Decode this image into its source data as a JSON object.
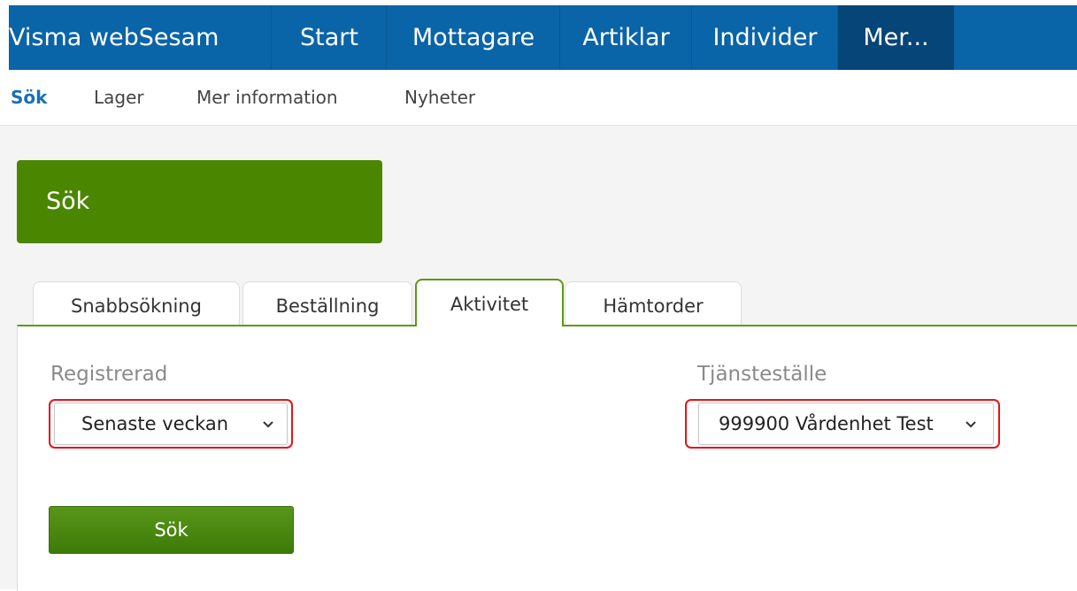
{
  "app": {
    "brand": "Visma webSesam"
  },
  "nav": {
    "items": [
      {
        "label": "Start"
      },
      {
        "label": "Mottagare"
      },
      {
        "label": "Artiklar"
      },
      {
        "label": "Individer"
      },
      {
        "label": "Mer..."
      }
    ],
    "active": "Mer..."
  },
  "subnav": {
    "items": [
      {
        "label": "Sök"
      },
      {
        "label": "Lager"
      },
      {
        "label": "Mer information"
      },
      {
        "label": "Nyheter"
      }
    ],
    "active": "Sök"
  },
  "page": {
    "title": "Sök"
  },
  "tabs": {
    "items": [
      {
        "label": "Snabbsökning"
      },
      {
        "label": "Beställning"
      },
      {
        "label": "Aktivitet"
      },
      {
        "label": "Hämtorder"
      }
    ],
    "active": "Aktivitet"
  },
  "form": {
    "registrerad_label": "Registrerad",
    "registrerad_value": "Senaste veckan",
    "tjanstestalle_label": "Tjänsteställe",
    "tjanstestalle_value": "999900 Vårdenhet Test",
    "search_button": "Sök"
  },
  "colors": {
    "navbar": "#0a64a8",
    "navbar_active": "#064578",
    "header_green": "#4b8600",
    "tab_accent": "#5a9a12",
    "highlight_outline": "#e3141b"
  },
  "icons": {
    "select_chevron": "chevron-down-icon"
  }
}
